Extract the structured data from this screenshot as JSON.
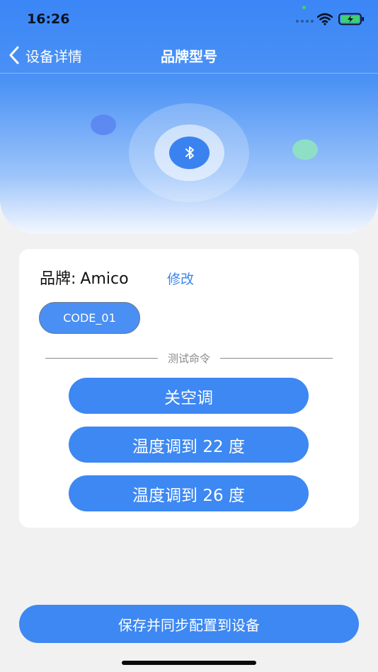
{
  "status_bar": {
    "time": "16:26"
  },
  "nav": {
    "back_label": "设备详情",
    "title": "品牌型号"
  },
  "device": {
    "brand_label": "品牌:",
    "brand_value": "Amico",
    "edit_label": "修改",
    "code_chip": "CODE_01"
  },
  "test_section": {
    "title": "测试命令",
    "commands": [
      "关空调",
      "温度调到 22 度",
      "温度调到 26 度"
    ]
  },
  "footer": {
    "save_label": "保存并同步配置到设备"
  },
  "colors": {
    "accent": "#3d88f2",
    "link": "#3a86e8",
    "background": "#f1f1f1"
  },
  "icons": {
    "back": "chevron-left-icon",
    "center": "bluetooth-icon",
    "wifi": "wifi-icon",
    "battery": "battery-charging-icon"
  }
}
